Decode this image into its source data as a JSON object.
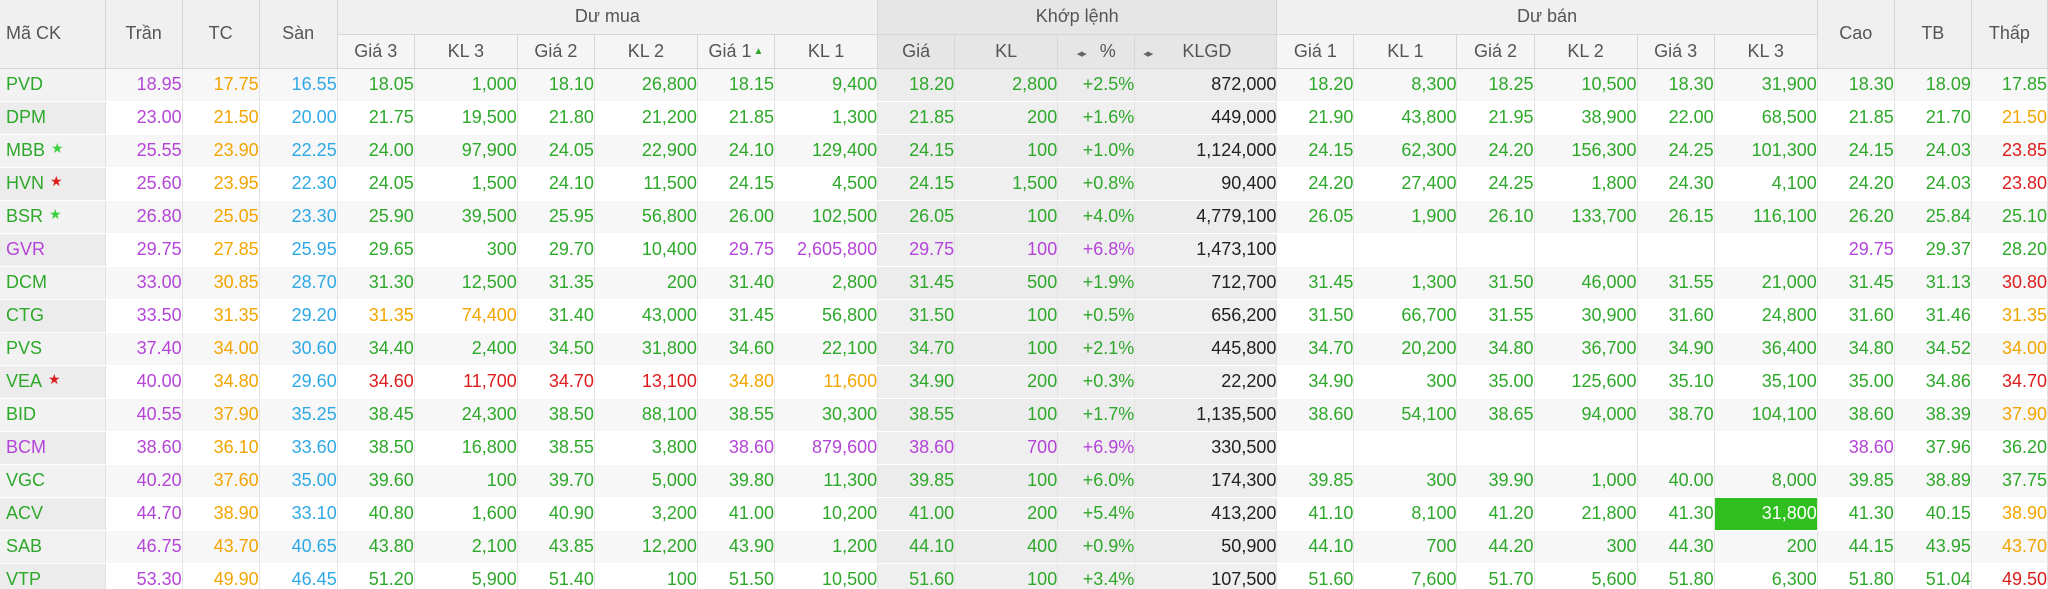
{
  "colors": {
    "up": "#2ea82a",
    "down": "#dd1c1c",
    "ref": "#f2a500",
    "ceil": "#b445d8",
    "floor": "#2fa9e6",
    "neutral": "#222222",
    "star_green": "#3cd13c",
    "star_red": "#dd1c1c",
    "flash": "#2fbf1f"
  },
  "headers": {
    "sym": "Mã CK",
    "ceil": "Trần",
    "ref": "TC",
    "floor": "Sàn",
    "bid_group": "Dư mua",
    "match_group": "Khớp lệnh",
    "ask_group": "Dư bán",
    "high": "Cao",
    "avg": "TB",
    "low": "Thấp",
    "bid_p3": "Giá 3",
    "bid_v3": "KL 3",
    "bid_p2": "Giá 2",
    "bid_v2": "KL 2",
    "bid_p1": "Giá 1",
    "bid_v1": "KL 1",
    "m_price": "Giá",
    "m_vol": "KL",
    "m_pct": "%",
    "m_total": "KLGD",
    "ask_p1": "Giá 1",
    "ask_v1": "KL 1",
    "ask_p2": "Giá 2",
    "ask_v2": "KL 2",
    "ask_p3": "Giá 3",
    "ask_v3": "KL 3"
  },
  "icons": {
    "sort_up": "▲",
    "toggle": "◂▸",
    "star": "★"
  },
  "rows": [
    {
      "sym": "PVD",
      "sym_c": "up",
      "star": "",
      "ceil": "18.95",
      "ref": "17.75",
      "floor": "16.55",
      "b3p": "18.05",
      "b3v": "1,000",
      "b3c": "up",
      "b2p": "18.10",
      "b2v": "26,800",
      "b2c": "up",
      "b1p": "18.15",
      "b1v": "9,400",
      "b1c": "up",
      "mp": "18.20",
      "mv": "2,800",
      "mpct": "+2.5%",
      "mc": "up",
      "tot": "872,000",
      "a1p": "18.20",
      "a1v": "8,300",
      "a1c": "up",
      "a2p": "18.25",
      "a2v": "10,500",
      "a2c": "up",
      "a3p": "18.30",
      "a3v": "31,900",
      "a3c": "up",
      "hi": "18.30",
      "hic": "up",
      "avg": "18.09",
      "avgc": "up",
      "lo": "17.85",
      "loc": "up"
    },
    {
      "sym": "DPM",
      "sym_c": "up",
      "star": "",
      "ceil": "23.00",
      "ref": "21.50",
      "floor": "20.00",
      "b3p": "21.75",
      "b3v": "19,500",
      "b3c": "up",
      "b2p": "21.80",
      "b2v": "21,200",
      "b2c": "up",
      "b1p": "21.85",
      "b1v": "1,300",
      "b1c": "up",
      "mp": "21.85",
      "mv": "200",
      "mpct": "+1.6%",
      "mc": "up",
      "tot": "449,000",
      "a1p": "21.90",
      "a1v": "43,800",
      "a1c": "up",
      "a2p": "21.95",
      "a2v": "38,900",
      "a2c": "up",
      "a3p": "22.00",
      "a3v": "68,500",
      "a3c": "up",
      "hi": "21.85",
      "hic": "up",
      "avg": "21.70",
      "avgc": "up",
      "lo": "21.50",
      "loc": "ref"
    },
    {
      "sym": "MBB",
      "sym_c": "up",
      "star": "green",
      "ceil": "25.55",
      "ref": "23.90",
      "floor": "22.25",
      "b3p": "24.00",
      "b3v": "97,900",
      "b3c": "up",
      "b2p": "24.05",
      "b2v": "22,900",
      "b2c": "up",
      "b1p": "24.10",
      "b1v": "129,400",
      "b1c": "up",
      "mp": "24.15",
      "mv": "100",
      "mpct": "+1.0%",
      "mc": "up",
      "tot": "1,124,000",
      "a1p": "24.15",
      "a1v": "62,300",
      "a1c": "up",
      "a2p": "24.20",
      "a2v": "156,300",
      "a2c": "up",
      "a3p": "24.25",
      "a3v": "101,300",
      "a3c": "up",
      "hi": "24.15",
      "hic": "up",
      "avg": "24.03",
      "avgc": "up",
      "lo": "23.85",
      "loc": "down"
    },
    {
      "sym": "HVN",
      "sym_c": "up",
      "star": "red",
      "ceil": "25.60",
      "ref": "23.95",
      "floor": "22.30",
      "b3p": "24.05",
      "b3v": "1,500",
      "b3c": "up",
      "b2p": "24.10",
      "b2v": "11,500",
      "b2c": "up",
      "b1p": "24.15",
      "b1v": "4,500",
      "b1c": "up",
      "mp": "24.15",
      "mv": "1,500",
      "mpct": "+0.8%",
      "mc": "up",
      "tot": "90,400",
      "a1p": "24.20",
      "a1v": "27,400",
      "a1c": "up",
      "a2p": "24.25",
      "a2v": "1,800",
      "a2c": "up",
      "a3p": "24.30",
      "a3v": "4,100",
      "a3c": "up",
      "hi": "24.20",
      "hic": "up",
      "avg": "24.03",
      "avgc": "up",
      "lo": "23.80",
      "loc": "down"
    },
    {
      "sym": "BSR",
      "sym_c": "up",
      "star": "green",
      "ceil": "26.80",
      "ref": "25.05",
      "floor": "23.30",
      "b3p": "25.90",
      "b3v": "39,500",
      "b3c": "up",
      "b2p": "25.95",
      "b2v": "56,800",
      "b2c": "up",
      "b1p": "26.00",
      "b1v": "102,500",
      "b1c": "up",
      "mp": "26.05",
      "mv": "100",
      "mpct": "+4.0%",
      "mc": "up",
      "tot": "4,779,100",
      "a1p": "26.05",
      "a1v": "1,900",
      "a1c": "up",
      "a2p": "26.10",
      "a2v": "133,700",
      "a2c": "up",
      "a3p": "26.15",
      "a3v": "116,100",
      "a3c": "up",
      "hi": "26.20",
      "hic": "up",
      "avg": "25.84",
      "avgc": "up",
      "lo": "25.10",
      "loc": "up"
    },
    {
      "sym": "GVR",
      "sym_c": "ceil",
      "star": "",
      "ceil": "29.75",
      "ref": "27.85",
      "floor": "25.95",
      "b3p": "29.65",
      "b3v": "300",
      "b3c": "up",
      "b2p": "29.70",
      "b2v": "10,400",
      "b2c": "up",
      "b1p": "29.75",
      "b1v": "2,605,800",
      "b1c": "ceil",
      "mp": "29.75",
      "mv": "100",
      "mpct": "+6.8%",
      "mc": "ceil",
      "tot": "1,473,100",
      "a1p": "",
      "a1v": "",
      "a1c": "up",
      "a2p": "",
      "a2v": "",
      "a2c": "up",
      "a3p": "",
      "a3v": "",
      "a3c": "up",
      "hi": "29.75",
      "hic": "ceil",
      "avg": "29.37",
      "avgc": "up",
      "lo": "28.20",
      "loc": "up"
    },
    {
      "sym": "DCM",
      "sym_c": "up",
      "star": "",
      "ceil": "33.00",
      "ref": "30.85",
      "floor": "28.70",
      "b3p": "31.30",
      "b3v": "12,500",
      "b3c": "up",
      "b2p": "31.35",
      "b2v": "200",
      "b2c": "up",
      "b1p": "31.40",
      "b1v": "2,800",
      "b1c": "up",
      "mp": "31.45",
      "mv": "500",
      "mpct": "+1.9%",
      "mc": "up",
      "tot": "712,700",
      "a1p": "31.45",
      "a1v": "1,300",
      "a1c": "up",
      "a2p": "31.50",
      "a2v": "46,000",
      "a2c": "up",
      "a3p": "31.55",
      "a3v": "21,000",
      "a3c": "up",
      "hi": "31.45",
      "hic": "up",
      "avg": "31.13",
      "avgc": "up",
      "lo": "30.80",
      "loc": "down"
    },
    {
      "sym": "CTG",
      "sym_c": "up",
      "star": "",
      "ceil": "33.50",
      "ref": "31.35",
      "floor": "29.20",
      "b3p": "31.35",
      "b3v": "74,400",
      "b3c": "ref",
      "b2p": "31.40",
      "b2v": "43,000",
      "b2c": "up",
      "b1p": "31.45",
      "b1v": "56,800",
      "b1c": "up",
      "mp": "31.50",
      "mv": "100",
      "mpct": "+0.5%",
      "mc": "up",
      "tot": "656,200",
      "a1p": "31.50",
      "a1v": "66,700",
      "a1c": "up",
      "a2p": "31.55",
      "a2v": "30,900",
      "a2c": "up",
      "a3p": "31.60",
      "a3v": "24,800",
      "a3c": "up",
      "hi": "31.60",
      "hic": "up",
      "avg": "31.46",
      "avgc": "up",
      "lo": "31.35",
      "loc": "ref"
    },
    {
      "sym": "PVS",
      "sym_c": "up",
      "star": "",
      "ceil": "37.40",
      "ref": "34.00",
      "floor": "30.60",
      "b3p": "34.40",
      "b3v": "2,400",
      "b3c": "up",
      "b2p": "34.50",
      "b2v": "31,800",
      "b2c": "up",
      "b1p": "34.60",
      "b1v": "22,100",
      "b1c": "up",
      "mp": "34.70",
      "mv": "100",
      "mpct": "+2.1%",
      "mc": "up",
      "tot": "445,800",
      "a1p": "34.70",
      "a1v": "20,200",
      "a1c": "up",
      "a2p": "34.80",
      "a2v": "36,700",
      "a2c": "up",
      "a3p": "34.90",
      "a3v": "36,400",
      "a3c": "up",
      "hi": "34.80",
      "hic": "up",
      "avg": "34.52",
      "avgc": "up",
      "lo": "34.00",
      "loc": "ref"
    },
    {
      "sym": "VEA",
      "sym_c": "up",
      "star": "red",
      "ceil": "40.00",
      "ref": "34.80",
      "floor": "29.60",
      "b3p": "34.60",
      "b3v": "11,700",
      "b3c": "down",
      "b2p": "34.70",
      "b2v": "13,100",
      "b2c": "down",
      "b1p": "34.80",
      "b1v": "11,600",
      "b1c": "ref",
      "mp": "34.90",
      "mv": "200",
      "mpct": "+0.3%",
      "mc": "up",
      "tot": "22,200",
      "a1p": "34.90",
      "a1v": "300",
      "a1c": "up",
      "a2p": "35.00",
      "a2v": "125,600",
      "a2c": "up",
      "a3p": "35.10",
      "a3v": "35,100",
      "a3c": "up",
      "hi": "35.00",
      "hic": "up",
      "avg": "34.86",
      "avgc": "up",
      "lo": "34.70",
      "loc": "down"
    },
    {
      "sym": "BID",
      "sym_c": "up",
      "star": "",
      "ceil": "40.55",
      "ref": "37.90",
      "floor": "35.25",
      "b3p": "38.45",
      "b3v": "24,300",
      "b3c": "up",
      "b2p": "38.50",
      "b2v": "88,100",
      "b2c": "up",
      "b1p": "38.55",
      "b1v": "30,300",
      "b1c": "up",
      "mp": "38.55",
      "mv": "100",
      "mpct": "+1.7%",
      "mc": "up",
      "tot": "1,135,500",
      "a1p": "38.60",
      "a1v": "54,100",
      "a1c": "up",
      "a2p": "38.65",
      "a2v": "94,000",
      "a2c": "up",
      "a3p": "38.70",
      "a3v": "104,100",
      "a3c": "up",
      "hi": "38.60",
      "hic": "up",
      "avg": "38.39",
      "avgc": "up",
      "lo": "37.90",
      "loc": "ref"
    },
    {
      "sym": "BCM",
      "sym_c": "ceil",
      "star": "",
      "ceil": "38.60",
      "ref": "36.10",
      "floor": "33.60",
      "b3p": "38.50",
      "b3v": "16,800",
      "b3c": "up",
      "b2p": "38.55",
      "b2v": "3,800",
      "b2c": "up",
      "b1p": "38.60",
      "b1v": "879,600",
      "b1c": "ceil",
      "mp": "38.60",
      "mv": "700",
      "mpct": "+6.9%",
      "mc": "ceil",
      "tot": "330,500",
      "a1p": "",
      "a1v": "",
      "a1c": "up",
      "a2p": "",
      "a2v": "",
      "a2c": "up",
      "a3p": "",
      "a3v": "",
      "a3c": "up",
      "hi": "38.60",
      "hic": "ceil",
      "avg": "37.96",
      "avgc": "up",
      "lo": "36.20",
      "loc": "up"
    },
    {
      "sym": "VGC",
      "sym_c": "up",
      "star": "",
      "ceil": "40.20",
      "ref": "37.60",
      "floor": "35.00",
      "b3p": "39.60",
      "b3v": "100",
      "b3c": "up",
      "b2p": "39.70",
      "b2v": "5,000",
      "b2c": "up",
      "b1p": "39.80",
      "b1v": "11,300",
      "b1c": "up",
      "mp": "39.85",
      "mv": "100",
      "mpct": "+6.0%",
      "mc": "up",
      "tot": "174,300",
      "a1p": "39.85",
      "a1v": "300",
      "a1c": "up",
      "a2p": "39.90",
      "a2v": "1,000",
      "a2c": "up",
      "a3p": "40.00",
      "a3v": "8,000",
      "a3c": "up",
      "hi": "39.85",
      "hic": "up",
      "avg": "38.89",
      "avgc": "up",
      "lo": "37.75",
      "loc": "up"
    },
    {
      "sym": "ACV",
      "sym_c": "up",
      "star": "",
      "ceil": "44.70",
      "ref": "38.90",
      "floor": "33.10",
      "b3p": "40.80",
      "b3v": "1,600",
      "b3c": "up",
      "b2p": "40.90",
      "b2v": "3,200",
      "b2c": "up",
      "b1p": "41.00",
      "b1v": "10,200",
      "b1c": "up",
      "mp": "41.00",
      "mv": "200",
      "mpct": "+5.4%",
      "mc": "up",
      "tot": "413,200",
      "a1p": "41.10",
      "a1v": "8,100",
      "a1c": "up",
      "a2p": "41.20",
      "a2v": "21,800",
      "a2c": "up",
      "a3p": "41.30",
      "a3v": "31,800",
      "a3c": "up",
      "flash": "a3v",
      "hi": "41.30",
      "hic": "up",
      "avg": "40.15",
      "avgc": "up",
      "lo": "38.90",
      "loc": "ref"
    },
    {
      "sym": "SAB",
      "sym_c": "up",
      "star": "",
      "ceil": "46.75",
      "ref": "43.70",
      "floor": "40.65",
      "b3p": "43.80",
      "b3v": "2,100",
      "b3c": "up",
      "b2p": "43.85",
      "b2v": "12,200",
      "b2c": "up",
      "b1p": "43.90",
      "b1v": "1,200",
      "b1c": "up",
      "mp": "44.10",
      "mv": "400",
      "mpct": "+0.9%",
      "mc": "up",
      "tot": "50,900",
      "a1p": "44.10",
      "a1v": "700",
      "a1c": "up",
      "a2p": "44.20",
      "a2v": "300",
      "a2c": "up",
      "a3p": "44.30",
      "a3v": "200",
      "a3c": "up",
      "hi": "44.15",
      "hic": "up",
      "avg": "43.95",
      "avgc": "up",
      "lo": "43.70",
      "loc": "ref"
    },
    {
      "sym": "VTP",
      "sym_c": "up",
      "star": "",
      "ceil": "53.30",
      "ref": "49.90",
      "floor": "46.45",
      "b3p": "51.20",
      "b3v": "5,900",
      "b3c": "up",
      "b2p": "51.40",
      "b2v": "100",
      "b2c": "up",
      "b1p": "51.50",
      "b1v": "10,500",
      "b1c": "up",
      "mp": "51.60",
      "mv": "100",
      "mpct": "+3.4%",
      "mc": "up",
      "tot": "107,500",
      "a1p": "51.60",
      "a1v": "7,600",
      "a1c": "up",
      "a2p": "51.70",
      "a2v": "5,600",
      "a2c": "up",
      "a3p": "51.80",
      "a3v": "6,300",
      "a3c": "up",
      "hi": "51.80",
      "hic": "up",
      "avg": "51.04",
      "avgc": "up",
      "lo": "49.50",
      "loc": "down"
    }
  ]
}
